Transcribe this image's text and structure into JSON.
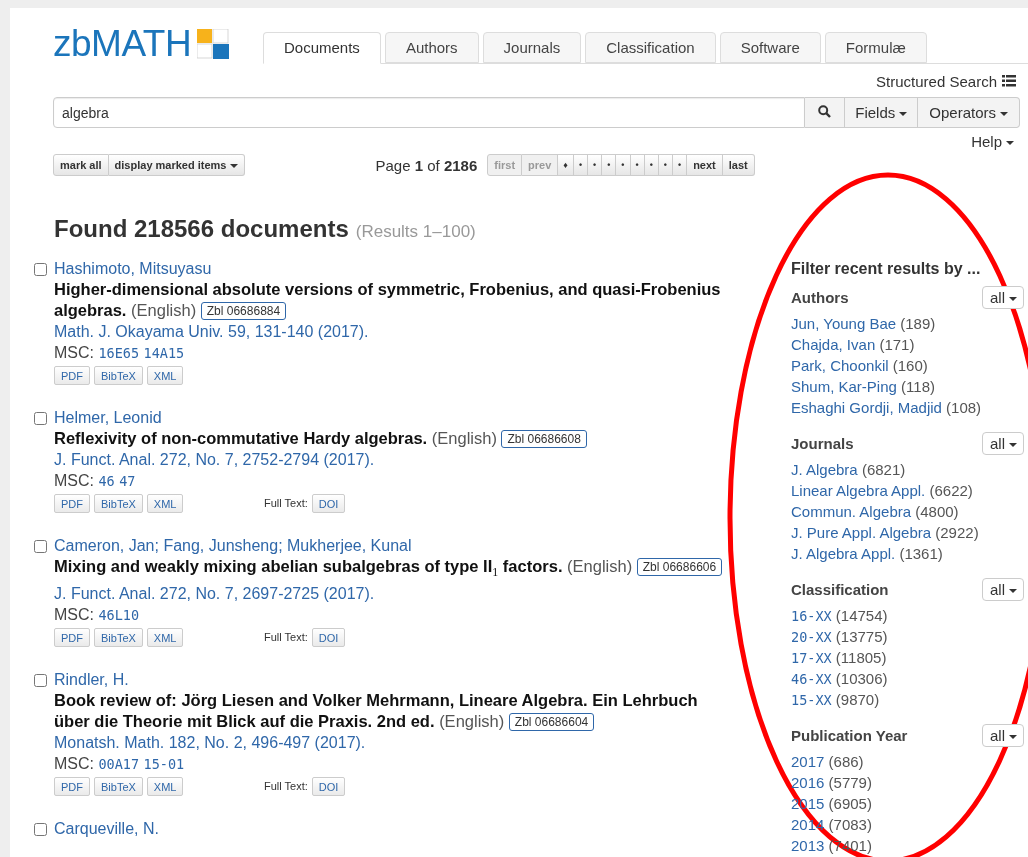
{
  "logo": {
    "text": "zbMATH"
  },
  "tabs": [
    {
      "label": "Documents",
      "selected": true
    },
    {
      "label": "Authors",
      "selected": false
    },
    {
      "label": "Journals",
      "selected": false
    },
    {
      "label": "Classification",
      "selected": false
    },
    {
      "label": "Software",
      "selected": false
    },
    {
      "label": "Formulæ",
      "selected": false
    }
  ],
  "structured_search": "Structured Search",
  "search": {
    "value": "algebra",
    "fields": "Fields",
    "operators": "Operators"
  },
  "help": "Help",
  "toolbar": {
    "mark_all": "mark all",
    "display_marked": "display marked items",
    "page_info": "Page **1** of **2186**",
    "pagination": [
      {
        "label": "first",
        "disabled": true
      },
      {
        "label": "prev",
        "disabled": true
      },
      {
        "label": "♦",
        "disabled": false
      },
      {
        "label": "•",
        "disabled": false
      },
      {
        "label": "•",
        "disabled": false
      },
      {
        "label": "•",
        "disabled": false
      },
      {
        "label": "•",
        "disabled": false
      },
      {
        "label": "•",
        "disabled": false
      },
      {
        "label": "•",
        "disabled": false
      },
      {
        "label": "•",
        "disabled": false
      },
      {
        "label": "•",
        "disabled": false
      },
      {
        "label": "next",
        "disabled": false
      },
      {
        "label": "last",
        "disabled": false
      }
    ]
  },
  "found": "Found 218566 documents",
  "results_range": "(Results 1–100)",
  "results": [
    {
      "checked": false,
      "authors": "Hashimoto, Mitsuyasu",
      "title": "Higher-dimensional absolute versions of symmetric, Frobenius, and quasi-Frobenius algebras.",
      "language": "(English)",
      "zbl": "Zbl 06686884",
      "source": "Math. J. Okayama Univ. 59, 131-140 (2017).",
      "msc_label": "MSC:",
      "msc": [
        "16E65",
        "14A15"
      ],
      "links": [
        "PDF",
        "BibTeX",
        "XML"
      ]
    },
    {
      "checked": false,
      "authors": "Helmer, Leonid",
      "title": "Reflexivity of non-commutative Hardy algebras.",
      "language": "(English)",
      "zbl": "Zbl 06686608",
      "source": "J. Funct. Anal. 272, No. 7, 2752-2794 (2017).",
      "msc_label": "MSC:",
      "msc": [
        "46",
        "47"
      ],
      "links": [
        "PDF",
        "BibTeX",
        "XML"
      ],
      "full_text_label": "Full Text:",
      "full_text_links": [
        "DOI"
      ]
    },
    {
      "checked": false,
      "authors": "Cameron, Jan; Fang, Junsheng; Mukherjee, Kunal",
      "title": "Mixing and weakly mixing abelian subalgebras of type II$_{1}$ factors.",
      "language": "(English)",
      "zbl": "Zbl 06686606",
      "source": "J. Funct. Anal. 272, No. 7, 2697-2725 (2017).",
      "msc_label": "MSC:",
      "msc": [
        "46L10"
      ],
      "links": [
        "PDF",
        "BibTeX",
        "XML"
      ],
      "full_text_label": "Full Text:",
      "full_text_links": [
        "DOI"
      ]
    },
    {
      "checked": false,
      "authors": "Rindler, H.",
      "title": "Book review of: Jörg Liesen and Volker Mehrmann, Lineare Algebra. Ein Lehrbuch über die Theorie mit Blick auf die Praxis. 2nd ed.",
      "language": "(English)",
      "zbl": "Zbl 06686604",
      "source": "Monatsh. Math. 182, No. 2, 496-497 (2017).",
      "msc_label": "MSC:",
      "msc": [
        "00A17",
        "15-01"
      ],
      "links": [
        "PDF",
        "BibTeX",
        "XML"
      ],
      "full_text_label": "Full Text:",
      "full_text_links": [
        "DOI"
      ]
    },
    {
      "checked": false,
      "authors": "Carqueville, N."
    }
  ],
  "filters": {
    "heading": "Filter recent results by ...",
    "groups": [
      {
        "title": "Authors",
        "kind": "text",
        "dropdown": "all",
        "items": [
          {
            "label": "Jun, Young Bae",
            "count": "(189)"
          },
          {
            "label": "Chajda, Ivan",
            "count": "(171)"
          },
          {
            "label": "Park, Choonkil",
            "count": "(160)"
          },
          {
            "label": "Shum, Kar-Ping",
            "count": "(118)"
          },
          {
            "label": "Eshaghi Gordji, Madjid",
            "count": "(108)"
          }
        ]
      },
      {
        "title": "Journals",
        "kind": "text",
        "dropdown": "all",
        "items": [
          {
            "label": "J. Algebra",
            "count": "(6821)"
          },
          {
            "label": "Linear Algebra Appl.",
            "count": "(6622)"
          },
          {
            "label": "Commun. Algebra",
            "count": "(4800)"
          },
          {
            "label": "J. Pure Appl. Algebra",
            "count": "(2922)"
          },
          {
            "label": "J. Algebra Appl.",
            "count": "(1361)"
          }
        ]
      },
      {
        "title": "Classification",
        "kind": "code",
        "dropdown": "all",
        "items": [
          {
            "label": "16-XX",
            "count": "(14754)"
          },
          {
            "label": "20-XX",
            "count": "(13775)"
          },
          {
            "label": "17-XX",
            "count": "(11805)"
          },
          {
            "label": "46-XX",
            "count": "(10306)"
          },
          {
            "label": "15-XX",
            "count": "(9870)"
          }
        ]
      },
      {
        "title": "Publication Year",
        "kind": "text",
        "dropdown": "all",
        "items": [
          {
            "label": "2017",
            "count": "(686)"
          },
          {
            "label": "2016",
            "count": "(5779)"
          },
          {
            "label": "2015",
            "count": "(6905)"
          },
          {
            "label": "2014",
            "count": "(7083)"
          },
          {
            "label": "2013",
            "count": "(7401)"
          }
        ]
      }
    ]
  },
  "annotation": {
    "kind": "ellipse",
    "color": "#ff0000"
  }
}
